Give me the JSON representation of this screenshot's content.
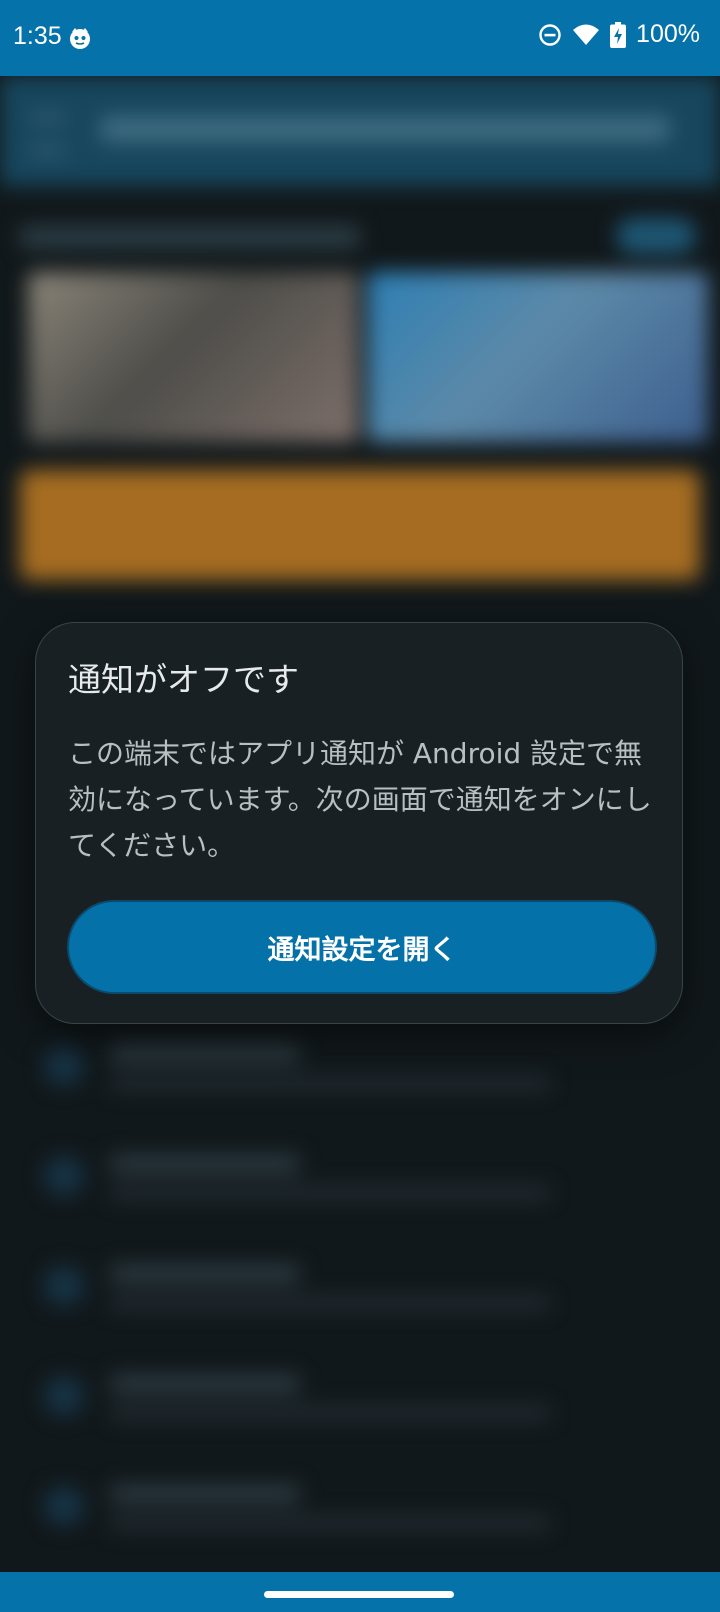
{
  "status_bar": {
    "time": "1:35",
    "battery_percent": "100%",
    "icons": [
      "app-notification-icon",
      "do-not-disturb-icon",
      "wifi-icon",
      "battery-charging-icon"
    ],
    "background_color": "#0572a9"
  },
  "dialog": {
    "title": "通知がオフです",
    "message": "この端末ではアプリ通知が Android 設定で無効になっています。次の画面で通知をオンにしてください。",
    "primary_button_label": "通知設定を開く",
    "accent_color": "#0571a9"
  }
}
